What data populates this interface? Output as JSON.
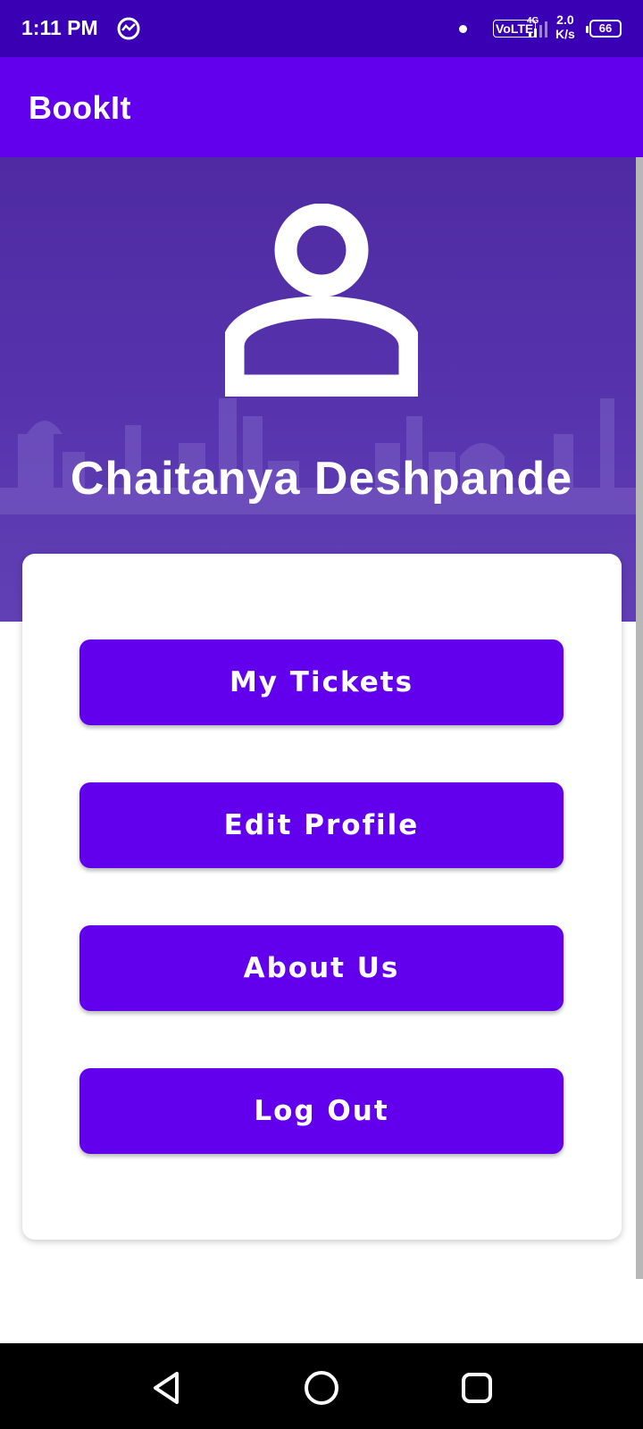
{
  "status_bar": {
    "time": "1:11 PM",
    "volte": "VoLTE",
    "network": "4G",
    "speed_value": "2.0",
    "speed_unit": "K/s",
    "battery": "66"
  },
  "app_bar": {
    "title": "BookIt"
  },
  "profile": {
    "name": "Chaitanya Deshpande",
    "avatar_icon": "person-icon"
  },
  "menu": {
    "buttons": [
      {
        "label": "My Tickets"
      },
      {
        "label": "Edit Profile"
      },
      {
        "label": "About Us"
      },
      {
        "label": "Log Out"
      }
    ]
  },
  "colors": {
    "primary": "#6200ee",
    "status_bar": "#3a00b4",
    "hero": "#5633ad",
    "nav_bar": "#000000"
  }
}
